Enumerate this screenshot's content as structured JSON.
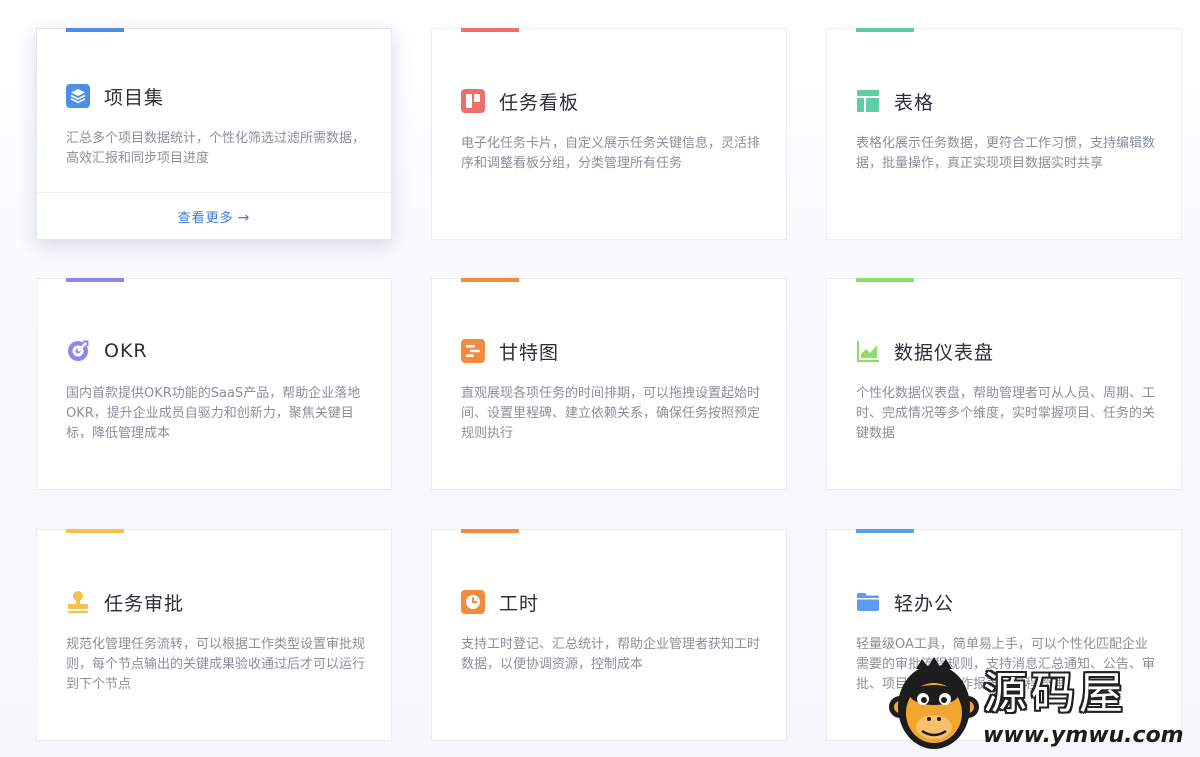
{
  "cards": [
    {
      "title": "项目集",
      "desc": "汇总多个项目数据统计，个性化筛选过滤所需数据，高效汇报和同步项目进度",
      "more": "查看更多",
      "accent": "#4f8ee6",
      "icon": "layers-icon",
      "hovered": true
    },
    {
      "title": "任务看板",
      "desc": "电子化任务卡片，自定义展示任务关键信息，灵活排序和调整看板分组，分类管理所有任务",
      "accent": "#ee6e6a",
      "icon": "kanban-icon"
    },
    {
      "title": "表格",
      "desc": "表格化展示任务数据，更符合工作习惯，支持编辑数据，批量操作，真正实现项目数据实时共享",
      "accent": "#5fcca3",
      "icon": "table-icon"
    },
    {
      "title": "OKR",
      "desc": "国内首款提供OKR功能的SaaS产品，帮助企业落地OKR，提升企业成员自驱力和创新力，聚焦关键目标，降低管理成本",
      "accent": "#8c87f0",
      "icon": "target-icon"
    },
    {
      "title": "甘特图",
      "desc": "直观展现各项任务的时间排期，可以拖拽设置起始时间、设置里程碑、建立依赖关系，确保任务按照预定规则执行",
      "accent": "#f28b3e",
      "icon": "gantt-icon"
    },
    {
      "title": "数据仪表盘",
      "desc": "个性化数据仪表盘，帮助管理者可从人员、周期、工时、完成情况等多个维度，实时掌握项目、任务的关键数据",
      "accent": "#8fdc6e",
      "icon": "dashboard-chart-icon"
    },
    {
      "title": "任务审批",
      "desc": "规范化管理任务流转，可以根据工作类型设置审批规则，每个节点输出的关键成果验收通过后才可以运行到下个节点",
      "accent": "#f6c04a",
      "icon": "stamp-icon"
    },
    {
      "title": "工时",
      "desc": "支持工时登记、汇总统计，帮助企业管理者获知工时数据，以便协调资源，控制成本",
      "accent": "#f28b3e",
      "icon": "clock-icon"
    },
    {
      "title": "轻办公",
      "desc": "轻量级OA工具，简单易上手，可以个性化匹配企业需要的审批流程规则，支持消息汇总通知、公告、审批、项目管理、工作报表、日程管理",
      "accent": "#5b9cf0",
      "icon": "folder-icon"
    }
  ],
  "watermark": {
    "name": "源码屋",
    "url": "www.ymwu.com",
    "icon": "monkey-logo-icon"
  }
}
